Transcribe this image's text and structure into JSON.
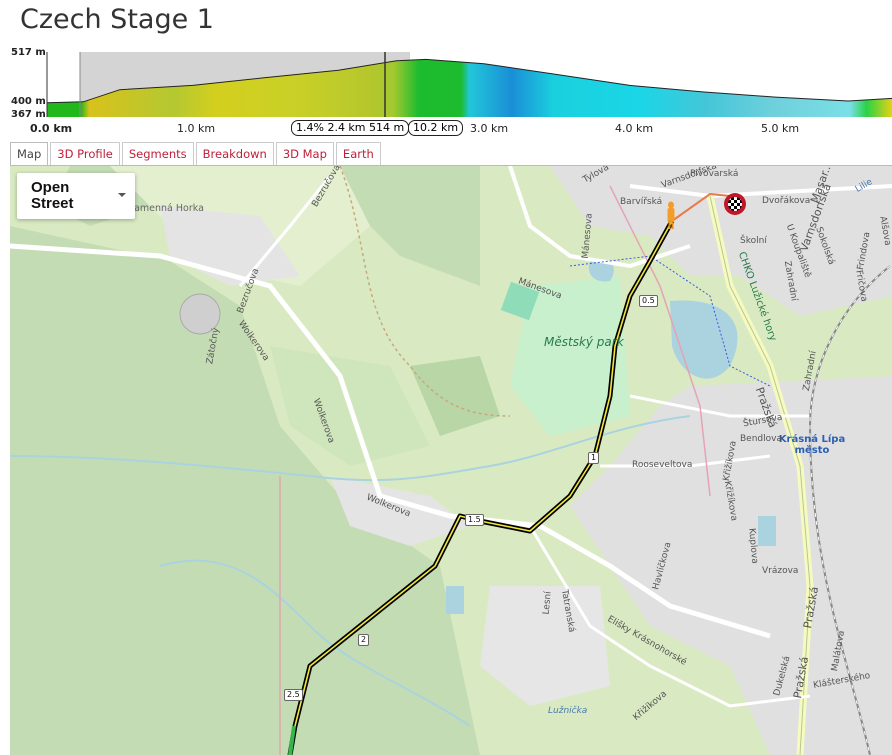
{
  "page": {
    "title": "Czech Stage 1"
  },
  "profile": {
    "y_labels": {
      "top": "517 m",
      "mid": "400 m",
      "bottom": "367 m"
    },
    "x_labels": [
      "0.0 km",
      "1.0 km",
      "3.0 km",
      "4.0 km",
      "5.0 km"
    ],
    "chip_segment": "1.4% 2.4 km 514 m",
    "chip_distance": "10.2 km",
    "chart_data": {
      "type": "area",
      "x": [
        0.0,
        0.25,
        0.5,
        1.0,
        1.5,
        2.0,
        2.4,
        2.6,
        3.0,
        3.5,
        4.0,
        4.5,
        5.0,
        5.5,
        5.8
      ],
      "y": [
        400,
        402,
        430,
        440,
        458,
        475,
        497,
        500,
        490,
        465,
        440,
        425,
        413,
        404,
        410
      ],
      "ylim": [
        367,
        517
      ],
      "xlim": [
        0,
        5.8
      ]
    }
  },
  "tabs": [
    "Map",
    "3D Profile",
    "Segments",
    "Breakdown",
    "3D Map",
    "Earth"
  ],
  "map": {
    "layer": "Open Street",
    "labels": {
      "hill": "Kamenná Horka",
      "park": "Městský park",
      "town": "Krásná Lípa město",
      "streets": {
        "bezrucova_top": "Bezručova",
        "bezrucova_left": "Bezručova",
        "wolkerova_1": "Wolkerova",
        "wolkerova_2": "Wolkerova",
        "wolkerova_3": "Wolkerova",
        "zatocny": "Zátočný",
        "manesova_1": "Mánesova",
        "manesova_2": "Mánesova",
        "tylova": "Tylova",
        "barvirska": "Barvířská",
        "pivovarska": "Pivovarská",
        "dvorakova": "Dvořákova",
        "skolni": "Školní",
        "varnsdorfska": "Varnsdorfská",
        "masaryk": "Masar...",
        "sokolska": "Sokolská",
        "u_hriste": "U Koupaliště",
        "zahradni_1": "Zahradní",
        "zahradni_2": "Zahradní",
        "frindova": "Frindova",
        "alsova": "Alšova",
        "fricova": "Fričova",
        "prazska_1": "Pražská",
        "prazska_2": "Pražská",
        "prazska_3": "Pražská",
        "stursova": "Štursova",
        "bendlova": "Bendlova",
        "rooseveltova": "Rooseveltova",
        "krizkova_1": "Křižíkova",
        "krizkova_2": "Křižíkova",
        "krizkova_3": "Křižíkova",
        "havlickova": "Havlíčkova",
        "kuplova": "Kuplova",
        "vrazova": "Vrázova",
        "lesni": "Lesní",
        "tatranska": "Tatranská",
        "elisky": "Elišky Krásnohorské",
        "dukelska": "Dukelská",
        "malatova": "Malátova",
        "klasterskeho": "Klášterského",
        "luznicka": "Lužnička",
        "chko": "CHKO Lužické hory",
        "lilie": "Lilie",
        "varnsd_2": "Varnsdorfská"
      }
    },
    "km_markers": [
      "0.5",
      "1",
      "1.5",
      "2",
      "2.5"
    ],
    "colors": {
      "forest": "#c4dcb4",
      "meadow": "#d6e9bc",
      "residential": "#e0e0e0",
      "water": "#aad3df",
      "route_black": "#000000",
      "route_yellow": "#f2e43a",
      "highway": "#f7fabf",
      "tab_link": "#c0203a"
    }
  }
}
